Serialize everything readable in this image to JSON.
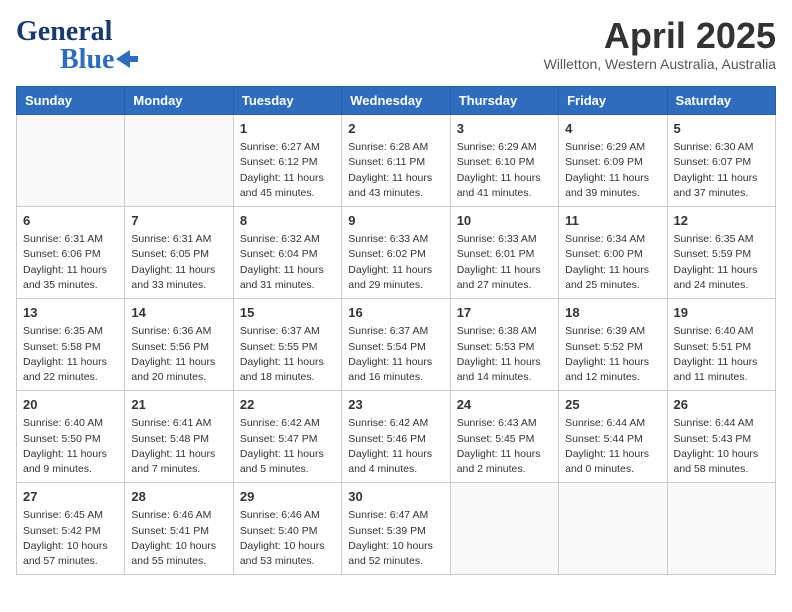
{
  "header": {
    "logo_g": "G",
    "logo_eneral": "eneral",
    "logo_blue": "Blue",
    "month": "April 2025",
    "location": "Willetton, Western Australia, Australia"
  },
  "days_of_week": [
    "Sunday",
    "Monday",
    "Tuesday",
    "Wednesday",
    "Thursday",
    "Friday",
    "Saturday"
  ],
  "weeks": [
    [
      {
        "day": "",
        "detail": ""
      },
      {
        "day": "",
        "detail": ""
      },
      {
        "day": "1",
        "detail": "Sunrise: 6:27 AM\nSunset: 6:12 PM\nDaylight: 11 hours and 45 minutes."
      },
      {
        "day": "2",
        "detail": "Sunrise: 6:28 AM\nSunset: 6:11 PM\nDaylight: 11 hours and 43 minutes."
      },
      {
        "day": "3",
        "detail": "Sunrise: 6:29 AM\nSunset: 6:10 PM\nDaylight: 11 hours and 41 minutes."
      },
      {
        "day": "4",
        "detail": "Sunrise: 6:29 AM\nSunset: 6:09 PM\nDaylight: 11 hours and 39 minutes."
      },
      {
        "day": "5",
        "detail": "Sunrise: 6:30 AM\nSunset: 6:07 PM\nDaylight: 11 hours and 37 minutes."
      }
    ],
    [
      {
        "day": "6",
        "detail": "Sunrise: 6:31 AM\nSunset: 6:06 PM\nDaylight: 11 hours and 35 minutes."
      },
      {
        "day": "7",
        "detail": "Sunrise: 6:31 AM\nSunset: 6:05 PM\nDaylight: 11 hours and 33 minutes."
      },
      {
        "day": "8",
        "detail": "Sunrise: 6:32 AM\nSunset: 6:04 PM\nDaylight: 11 hours and 31 minutes."
      },
      {
        "day": "9",
        "detail": "Sunrise: 6:33 AM\nSunset: 6:02 PM\nDaylight: 11 hours and 29 minutes."
      },
      {
        "day": "10",
        "detail": "Sunrise: 6:33 AM\nSunset: 6:01 PM\nDaylight: 11 hours and 27 minutes."
      },
      {
        "day": "11",
        "detail": "Sunrise: 6:34 AM\nSunset: 6:00 PM\nDaylight: 11 hours and 25 minutes."
      },
      {
        "day": "12",
        "detail": "Sunrise: 6:35 AM\nSunset: 5:59 PM\nDaylight: 11 hours and 24 minutes."
      }
    ],
    [
      {
        "day": "13",
        "detail": "Sunrise: 6:35 AM\nSunset: 5:58 PM\nDaylight: 11 hours and 22 minutes."
      },
      {
        "day": "14",
        "detail": "Sunrise: 6:36 AM\nSunset: 5:56 PM\nDaylight: 11 hours and 20 minutes."
      },
      {
        "day": "15",
        "detail": "Sunrise: 6:37 AM\nSunset: 5:55 PM\nDaylight: 11 hours and 18 minutes."
      },
      {
        "day": "16",
        "detail": "Sunrise: 6:37 AM\nSunset: 5:54 PM\nDaylight: 11 hours and 16 minutes."
      },
      {
        "day": "17",
        "detail": "Sunrise: 6:38 AM\nSunset: 5:53 PM\nDaylight: 11 hours and 14 minutes."
      },
      {
        "day": "18",
        "detail": "Sunrise: 6:39 AM\nSunset: 5:52 PM\nDaylight: 11 hours and 12 minutes."
      },
      {
        "day": "19",
        "detail": "Sunrise: 6:40 AM\nSunset: 5:51 PM\nDaylight: 11 hours and 11 minutes."
      }
    ],
    [
      {
        "day": "20",
        "detail": "Sunrise: 6:40 AM\nSunset: 5:50 PM\nDaylight: 11 hours and 9 minutes."
      },
      {
        "day": "21",
        "detail": "Sunrise: 6:41 AM\nSunset: 5:48 PM\nDaylight: 11 hours and 7 minutes."
      },
      {
        "day": "22",
        "detail": "Sunrise: 6:42 AM\nSunset: 5:47 PM\nDaylight: 11 hours and 5 minutes."
      },
      {
        "day": "23",
        "detail": "Sunrise: 6:42 AM\nSunset: 5:46 PM\nDaylight: 11 hours and 4 minutes."
      },
      {
        "day": "24",
        "detail": "Sunrise: 6:43 AM\nSunset: 5:45 PM\nDaylight: 11 hours and 2 minutes."
      },
      {
        "day": "25",
        "detail": "Sunrise: 6:44 AM\nSunset: 5:44 PM\nDaylight: 11 hours and 0 minutes."
      },
      {
        "day": "26",
        "detail": "Sunrise: 6:44 AM\nSunset: 5:43 PM\nDaylight: 10 hours and 58 minutes."
      }
    ],
    [
      {
        "day": "27",
        "detail": "Sunrise: 6:45 AM\nSunset: 5:42 PM\nDaylight: 10 hours and 57 minutes."
      },
      {
        "day": "28",
        "detail": "Sunrise: 6:46 AM\nSunset: 5:41 PM\nDaylight: 10 hours and 55 minutes."
      },
      {
        "day": "29",
        "detail": "Sunrise: 6:46 AM\nSunset: 5:40 PM\nDaylight: 10 hours and 53 minutes."
      },
      {
        "day": "30",
        "detail": "Sunrise: 6:47 AM\nSunset: 5:39 PM\nDaylight: 10 hours and 52 minutes."
      },
      {
        "day": "",
        "detail": ""
      },
      {
        "day": "",
        "detail": ""
      },
      {
        "day": "",
        "detail": ""
      }
    ]
  ]
}
